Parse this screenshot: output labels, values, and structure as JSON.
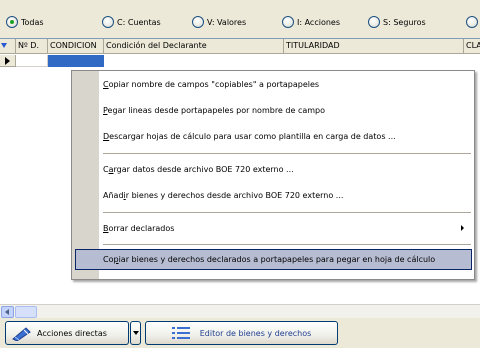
{
  "filters": [
    {
      "label": "Todas",
      "checked": true
    },
    {
      "label": "C: Cuentas",
      "checked": false
    },
    {
      "label": "V: Valores",
      "checked": false
    },
    {
      "label": "I: Acciones",
      "checked": false
    },
    {
      "label": "S: Seguros",
      "checked": false
    }
  ],
  "grid": {
    "columns": [
      "Nº D.",
      "CONDICION",
      "Condición del Declarante",
      "TITULARIDAD",
      "CLA"
    ]
  },
  "menu": {
    "items": [
      {
        "mnemonic": "C",
        "rest": "opiar nombre de campos \"copiables\" a portapapeles"
      },
      {
        "mnemonic": "P",
        "rest": "egar lineas desde portapapeles por nombre de campo"
      },
      {
        "mnemonic": "D",
        "rest": "escargar hojas de cálculo para usar como plantilla en carga de datos ..."
      },
      {
        "pre": "C",
        "mnemonic": "a",
        "rest": "rgar datos desde archivo BOE 720 externo ..."
      },
      {
        "pre": "Añad",
        "mnemonic": "i",
        "rest": "r bienes y derechos desde archivo BOE 720 externo ..."
      },
      {
        "mnemonic": "B",
        "rest": "orrar declarados"
      },
      {
        "pre": "Co",
        "mnemonic": "p",
        "rest": "iar bienes y derechos declarados a portapapeles para pegar en hoja de cálculo"
      }
    ]
  },
  "toolbar": {
    "acciones_label": "Acciones directas",
    "editor_label": "Editor de bienes y derechos"
  },
  "colors": {
    "selected_cell": "#316ac5",
    "menu_highlight": "#b6bdd2",
    "radio_checked": "#21a121"
  }
}
